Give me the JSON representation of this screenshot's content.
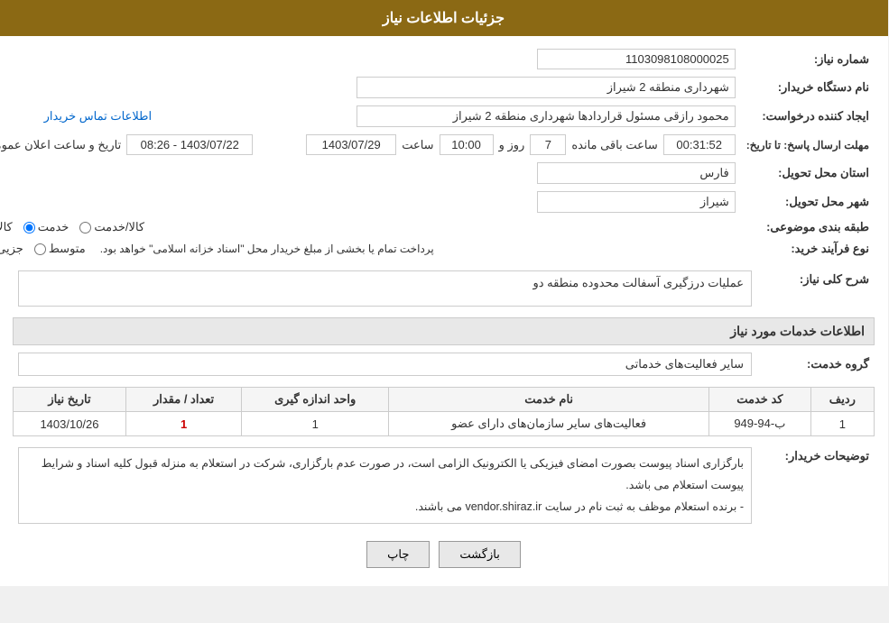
{
  "header": {
    "title": "جزئیات اطلاعات نیاز"
  },
  "fields": {
    "need_number_label": "شماره نیاز:",
    "need_number_value": "1103098108000025",
    "buyer_org_label": "نام دستگاه خریدار:",
    "buyer_org_value": "شهرداری منطقه 2 شیراز",
    "creator_label": "ایجاد کننده درخواست:",
    "creator_value": "محمود رازقی مسئول قراردادها شهرداری منطقه 2 شیراز",
    "contact_link": "اطلاعات تماس خریدار",
    "deadline_label": "مهلت ارسال پاسخ: تا تاریخ:",
    "announce_label": "تاریخ و ساعت اعلان عمومی:",
    "announce_date": "1403/07/22 - 08:26",
    "deadline_date": "1403/07/29",
    "deadline_time_label": "ساعت",
    "deadline_time": "10:00",
    "deadline_day_label": "روز و",
    "deadline_day": "7",
    "remaining_label": "ساعت باقی مانده",
    "remaining_time": "00:31:52",
    "province_label": "استان محل تحویل:",
    "province_value": "فارس",
    "city_label": "شهر محل تحویل:",
    "city_value": "شیراز",
    "category_label": "طبقه بندی موضوعی:",
    "category_kala": "کالا",
    "category_khadamat": "خدمت",
    "category_kala_khadamat": "کالا/خدمت",
    "purchase_type_label": "نوع فرآیند خرید:",
    "purchase_jozii": "جزیی",
    "purchase_motavaset": "متوسط",
    "purchase_note": "پرداخت تمام یا بخشی از مبلغ خریدار محل \"اسناد خزانه اسلامی\" خواهد بود."
  },
  "sharh_section": {
    "header": "شرح کلی نیاز:",
    "value": "عملیات درزگیری آسفالت محدوده منطقه دو"
  },
  "service_section": {
    "header": "اطلاعات خدمات مورد نیاز",
    "group_label": "گروه خدمت:",
    "group_value": "سایر فعالیت‌های خدماتی",
    "table": {
      "cols": [
        "ردیف",
        "کد خدمت",
        "نام خدمت",
        "واحد اندازه گیری",
        "تعداد / مقدار",
        "تاریخ نیاز"
      ],
      "rows": [
        {
          "row": "1",
          "code": "ب-94-949",
          "name": "فعالیت‌های سایر سازمان‌های دارای عضو",
          "unit": "1",
          "count": "1",
          "date": "1403/10/26"
        }
      ]
    }
  },
  "buyer_notes": {
    "label": "توضیحات خریدار:",
    "lines": [
      "بارگزاری اسناد پیوست بصورت امضای فیزیکی یا الکترونیک الزامی است، در صورت عدم بارگزاری، شرکت در استعلام به منزله قبول کلیه اسناد و شرایط پیوست استعلام می باشد.",
      "- برنده استعلام موظف به ثبت نام در سایت vendor.shiraz.ir می باشند."
    ]
  },
  "buttons": {
    "back_label": "بازگشت",
    "print_label": "چاپ"
  }
}
